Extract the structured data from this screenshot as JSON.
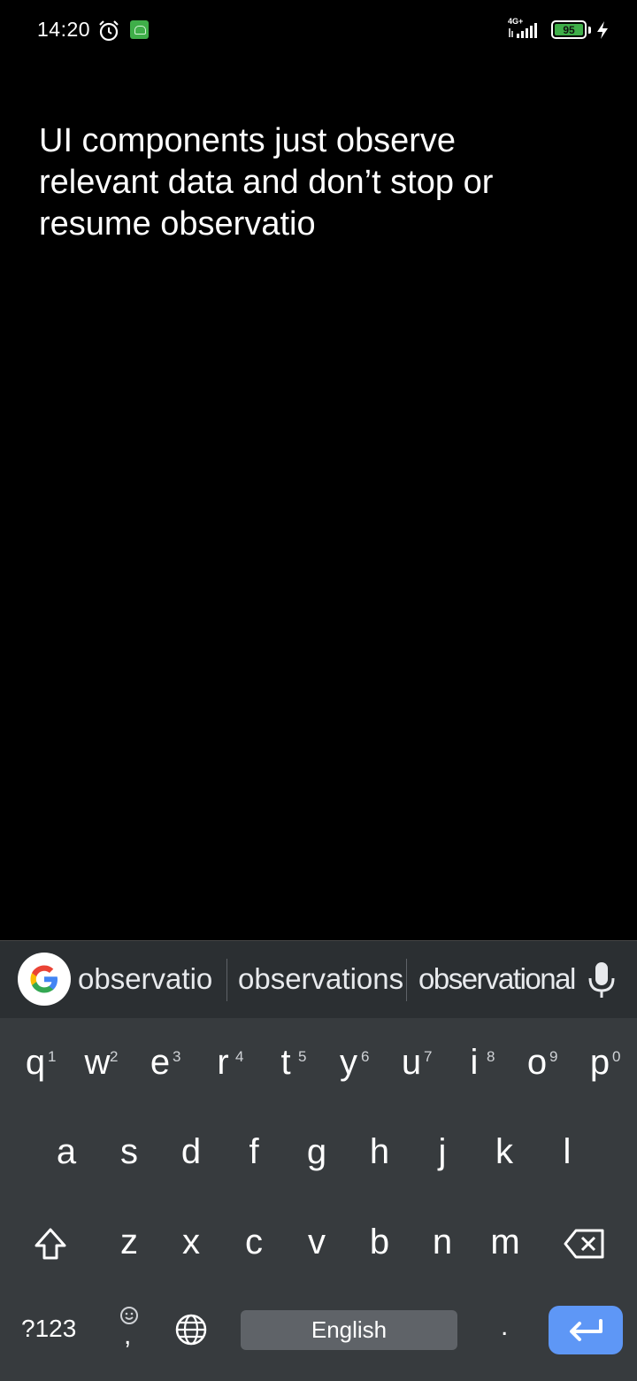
{
  "status_bar": {
    "time": "14:20",
    "network": "4G+",
    "battery": "95",
    "icons": [
      "alarm-icon",
      "app-notification-icon",
      "signal-icon",
      "battery-icon",
      "charging-icon"
    ]
  },
  "editor": {
    "text_line1": "UI components just observe",
    "text_line2": "relevant data and don’t stop or",
    "text_line3": "resume observatio"
  },
  "keyboard": {
    "suggestions": [
      "observatio",
      "observations",
      "observational"
    ],
    "row1": [
      {
        "key": "q",
        "hint": "1"
      },
      {
        "key": "w",
        "hint": "2"
      },
      {
        "key": "e",
        "hint": "3"
      },
      {
        "key": "r",
        "hint": "4"
      },
      {
        "key": "t",
        "hint": "5"
      },
      {
        "key": "y",
        "hint": "6"
      },
      {
        "key": "u",
        "hint": "7"
      },
      {
        "key": "i",
        "hint": "8"
      },
      {
        "key": "o",
        "hint": "9"
      },
      {
        "key": "p",
        "hint": "0"
      }
    ],
    "row2": [
      "a",
      "s",
      "d",
      "f",
      "g",
      "h",
      "j",
      "k",
      "l"
    ],
    "row3": [
      "z",
      "x",
      "c",
      "v",
      "b",
      "n",
      "m"
    ],
    "symbols_key": "?123",
    "comma_key": ",",
    "space_label": "English",
    "period_key": ".",
    "colors": {
      "background": "#373b3e",
      "suggest_bar": "#2b2f32",
      "enter": "#5e97f6",
      "space": "#5f6368"
    }
  }
}
